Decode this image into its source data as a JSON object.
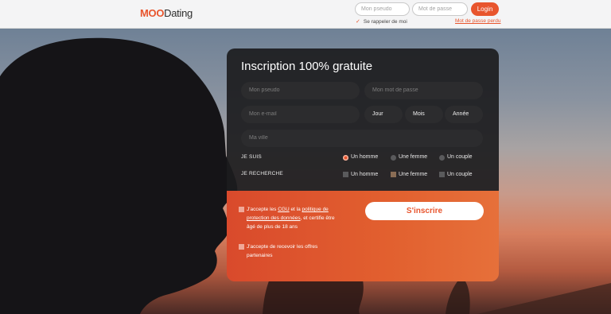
{
  "header": {
    "logo_mark": "MOO",
    "logo_text": "Dating",
    "pseudo_placeholder": "Mon pseudo",
    "password_placeholder": "Mot de passe",
    "login_label": "Login",
    "remember_label": "Se rappeler de moi",
    "forgot_label": "Mot de passe perdu",
    "check_icon": "✓"
  },
  "form": {
    "title": "Inscription 100% gratuite",
    "pseudo_placeholder": "Mon pseudo",
    "password_placeholder": "Mon mot de passe",
    "email_placeholder": "Mon e-mail",
    "day_label": "Jour",
    "month_label": "Mois",
    "year_label": "Année",
    "city_placeholder": "Ma ville",
    "i_am": {
      "label": "JE SUIS",
      "options": [
        "Un homme",
        "Une femme",
        "Un couple"
      ],
      "selected": "Un homme"
    },
    "looking_for": {
      "label": "JE RECHERCHE",
      "options": [
        "Un homme",
        "Une femme",
        "Un couple"
      ],
      "checked": [
        "Une femme"
      ]
    },
    "terms": {
      "part1": "J'accepte les ",
      "cgu": "CGU",
      "part2": " et la ",
      "privacy": "politique de protection des données",
      "part3": ", et certifie être âgé de plus de 18 ans"
    },
    "offers_label": "J'accepte de recevoir les offres partenaires",
    "submit_label": "S'inscrire"
  },
  "colors": {
    "accent": "#e8552d",
    "card_dark": "#1c1c1e",
    "card_orange": "#e2602f"
  }
}
